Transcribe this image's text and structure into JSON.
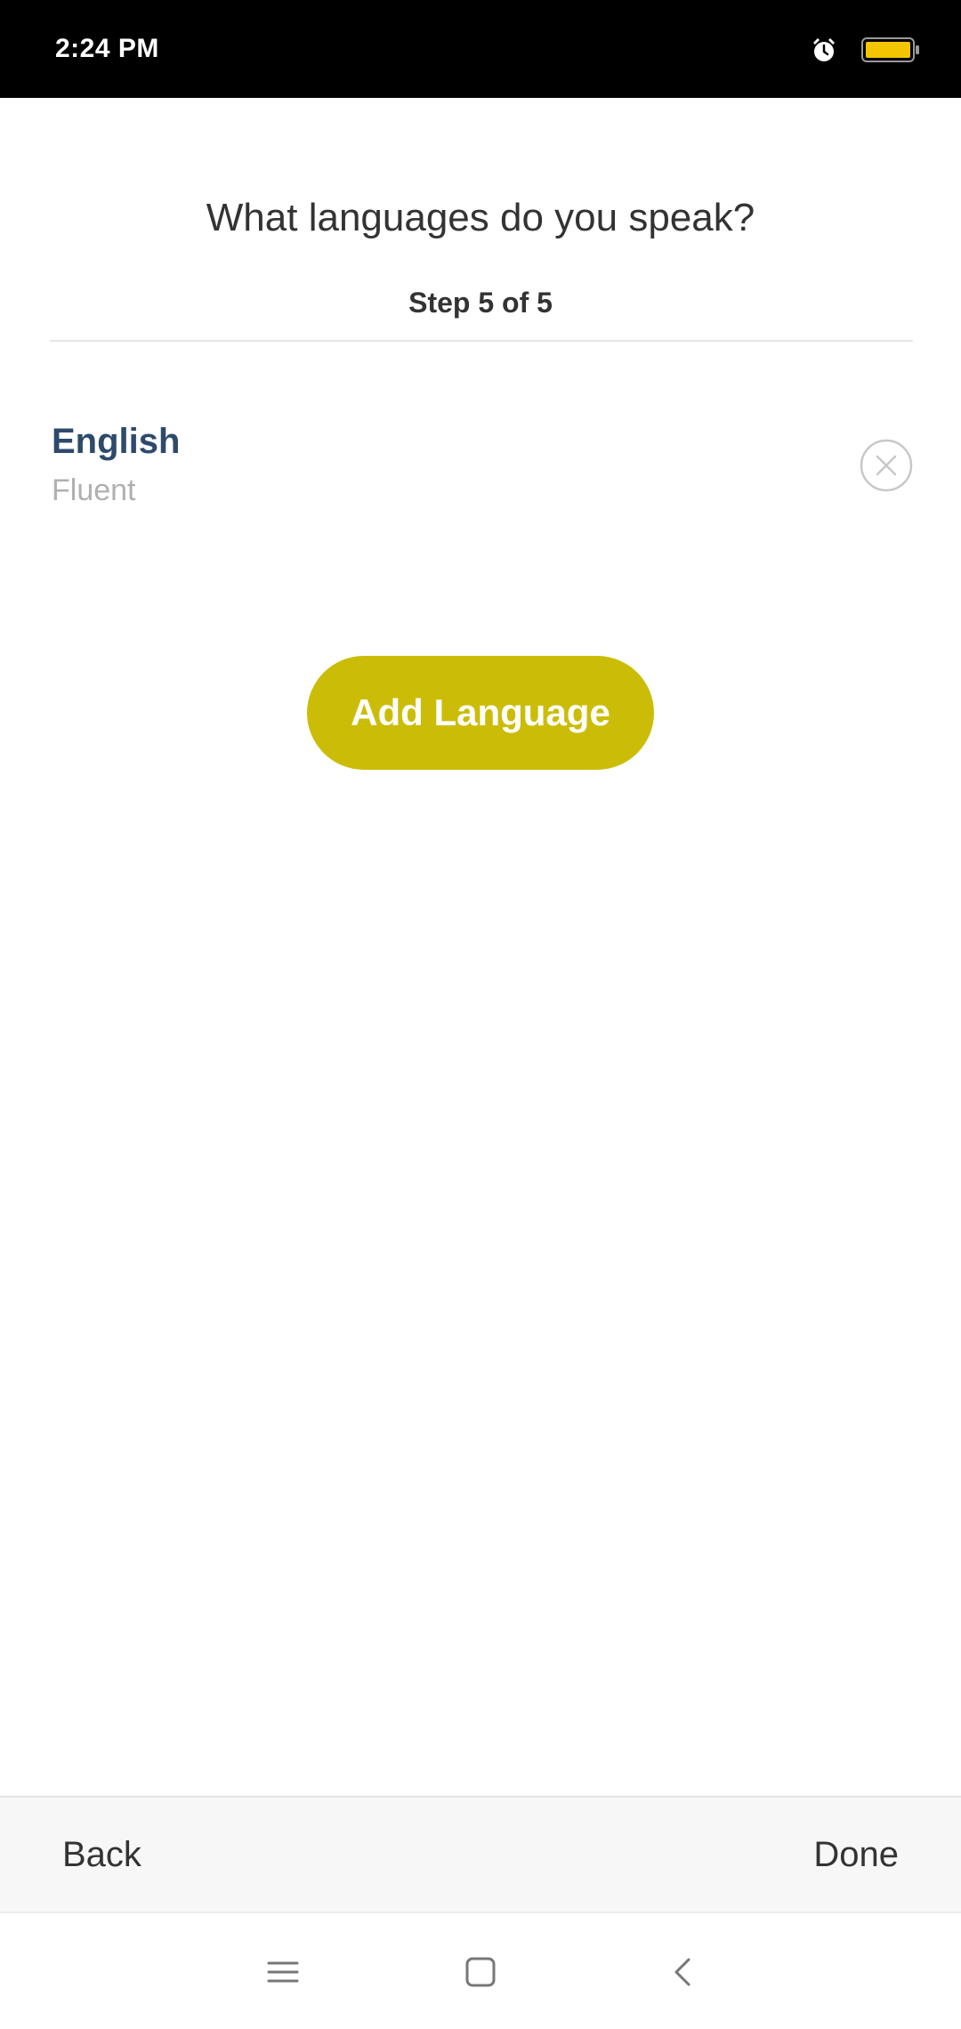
{
  "status_bar": {
    "time": "2:24 PM",
    "icons": [
      "alarm-icon",
      "battery-icon"
    ],
    "battery_color": "#f5c400"
  },
  "header": {
    "title": "What languages do you speak?",
    "step": "Step 5 of 5"
  },
  "languages": [
    {
      "name": "English",
      "level": "Fluent",
      "remove_icon": "close-circle-icon"
    }
  ],
  "add_language_button": {
    "label": "Add Language",
    "color": "#cbbd07"
  },
  "action_bar": {
    "back_label": "Back",
    "done_label": "Done"
  },
  "nav_bar": {
    "icons": [
      "menu-icon",
      "home-icon",
      "back-arrow-icon"
    ]
  },
  "colors": {
    "language_name": "#2e4a6b",
    "language_level": "#b0b0b0",
    "text": "#333333"
  }
}
